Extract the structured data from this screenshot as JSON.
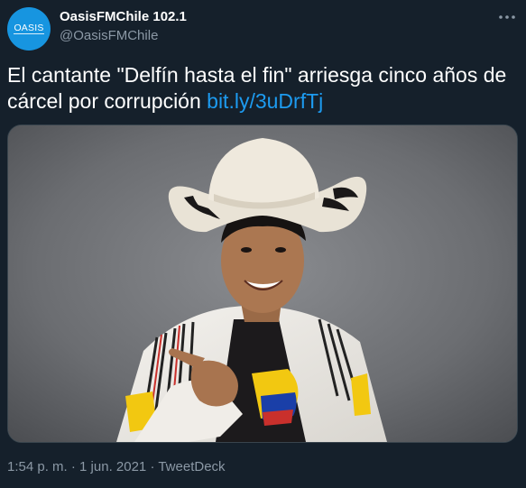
{
  "tweet": {
    "display_name": "OasisFMChile 102.1",
    "handle": "@OasisFMChile",
    "avatar_text": "OASIS",
    "text": "El cantante \"Delfín hasta el fin\" arriesga cinco años de cárcel por corrupción ",
    "link": "bit.ly/3uDrfTj",
    "time": "1:54 p. m.",
    "separator_1": " · ",
    "date": "1 jun. 2021",
    "separator_2": " · ",
    "source": "TweetDeck"
  },
  "icons": {
    "more": "more-dots-icon"
  },
  "colors": {
    "background": "#15202b",
    "secondary_text": "#8b98a5",
    "link": "#1d9bf0",
    "avatar": "#1795e0",
    "border": "#38444d"
  }
}
